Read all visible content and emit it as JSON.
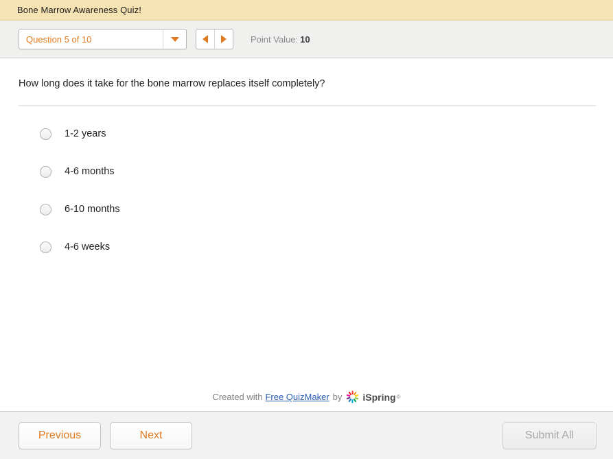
{
  "title_bar": {
    "title": "Bone Marrow Awareness Quiz!"
  },
  "toolbar": {
    "question_selector_value": "Question 5 of 10",
    "dropdown_icon": "chevron-down-icon",
    "prev_arrow_icon": "triangle-left-icon",
    "next_arrow_icon": "triangle-right-icon",
    "point_value_label": "Point Value:",
    "point_value_number": "10"
  },
  "question": {
    "text": "How long does it take for the bone marrow replaces itself completely?",
    "answers": [
      {
        "label": "1-2 years",
        "selected": false
      },
      {
        "label": "4-6 months",
        "selected": false
      },
      {
        "label": "6-10 months",
        "selected": false
      },
      {
        "label": "4-6 weeks",
        "selected": false
      }
    ]
  },
  "branding": {
    "prefix": "Created with",
    "link_text": "Free QuizMaker",
    "by": "by",
    "logo_icon": "ispring-pinwheel-icon",
    "product_name": "iSpring",
    "trademark": "®"
  },
  "footer": {
    "previous_label": "Previous",
    "next_label": "Next",
    "submit_label": "Submit All",
    "submit_disabled": true
  },
  "colors": {
    "title_bar_bg": "#f5e3b3",
    "accent_orange": "#e07b22",
    "toolbar_bg": "#f0f0ef",
    "footer_bg": "#f2f2f2",
    "link_blue": "#2a5db0",
    "disabled_gray": "#a8a8a8"
  }
}
